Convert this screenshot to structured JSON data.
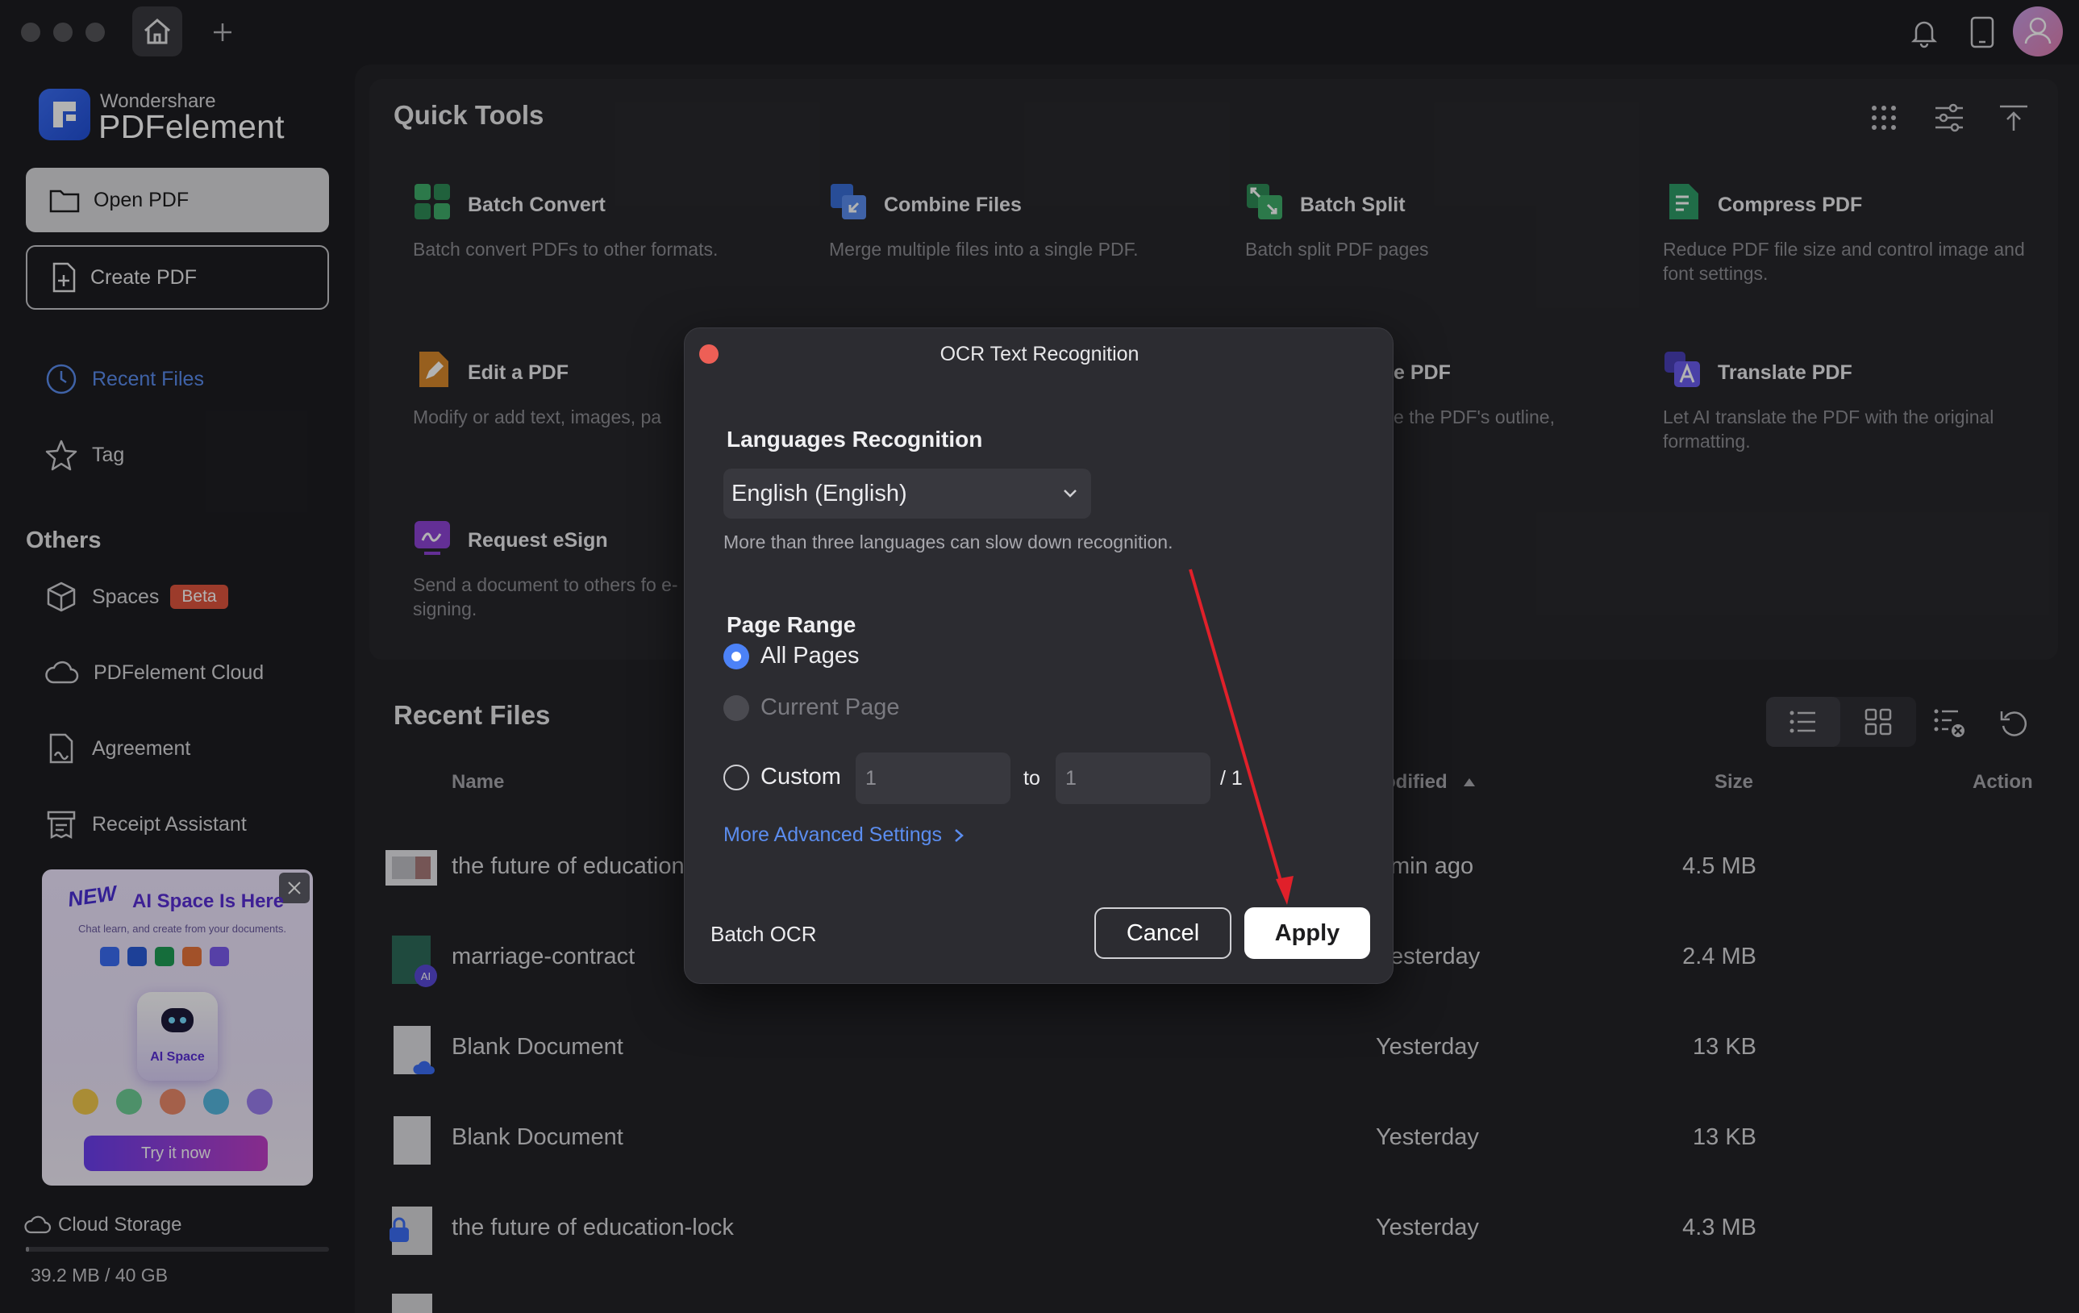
{
  "window": {
    "title_bar": {
      "home_tab_icon": "home-icon",
      "new_tab_icon": "plus-icon"
    }
  },
  "sidebar": {
    "brand_small": "Wondershare",
    "brand_big": "PDFelement",
    "open_pdf": "Open PDF",
    "create_pdf": "Create PDF",
    "nav": [
      {
        "label": "Recent Files",
        "icon": "clock-icon",
        "active": true
      },
      {
        "label": "Tag",
        "icon": "star-icon"
      }
    ],
    "others_title": "Others",
    "others": [
      {
        "label": "Spaces",
        "icon": "cube-icon",
        "badge": "Beta"
      },
      {
        "label": "PDFelement Cloud",
        "icon": "cloud-icon"
      },
      {
        "label": "Agreement",
        "icon": "agreement-icon"
      },
      {
        "label": "Receipt Assistant",
        "icon": "receipt-icon"
      }
    ],
    "promo": {
      "new_tag": "NEW",
      "title": "AI Space Is Here",
      "subtitle": "Chat learn, and create from your documents.",
      "core_label": "AI Space",
      "button": "Try it now"
    },
    "storage": {
      "label": "Cloud Storage",
      "value": "39.2 MB / 40 GB",
      "used_fraction": 0.001
    }
  },
  "quick_tools": {
    "title": "Quick Tools",
    "tools": [
      {
        "name": "Batch Convert",
        "desc": "Batch convert PDFs to other formats.",
        "icon": "batch-convert-icon"
      },
      {
        "name": "Combine Files",
        "desc": "Merge multiple files into a single PDF.",
        "icon": "combine-files-icon"
      },
      {
        "name": "Batch Split",
        "desc": "Batch split PDF pages",
        "icon": "batch-split-icon"
      },
      {
        "name": "Compress PDF",
        "desc": "Reduce PDF file size and control image and font settings.",
        "icon": "compress-pdf-icon"
      },
      {
        "name": "Edit a PDF",
        "desc": "Modify or add text, images, pa",
        "icon": "edit-pdf-icon"
      },
      {
        "name": "e PDF",
        "desc": "e the PDF's outline,",
        "icon": ""
      },
      {
        "name": "Translate PDF",
        "desc": "Let AI translate the PDF with the original formatting.",
        "icon": "translate-pdf-icon"
      },
      {
        "name": "Request eSign",
        "desc": "Send a document to others fo e-signing.",
        "icon": "esign-icon"
      }
    ]
  },
  "recent_files": {
    "title": "Recent Files",
    "columns": {
      "name": "Name",
      "modified": "odified",
      "size": "Size",
      "action": "Action"
    },
    "rows": [
      {
        "name": "the future of education",
        "modified": "min ago",
        "size": "4.5 MB"
      },
      {
        "name": "marriage-contract",
        "modified": "esterday",
        "size": "2.4 MB"
      },
      {
        "name": "Blank Document",
        "modified": "Yesterday",
        "size": "13 KB"
      },
      {
        "name": "Blank Document",
        "modified": "Yesterday",
        "size": "13 KB"
      },
      {
        "name": "the future of education-lock",
        "modified": "Yesterday",
        "size": "4.3 MB"
      }
    ]
  },
  "dialog": {
    "title": "OCR Text Recognition",
    "languages_heading": "Languages Recognition",
    "language_selected": "English (English)",
    "language_hint": "More than three languages can slow down recognition.",
    "page_range_heading": "Page Range",
    "options": {
      "all": "All Pages",
      "current": "Current Page",
      "custom": "Custom"
    },
    "custom_from": "1",
    "custom_to": "1",
    "to_label": "to",
    "of_label": "/ 1",
    "advanced": "More Advanced Settings",
    "batch_ocr": "Batch OCR",
    "cancel": "Cancel",
    "apply": "Apply"
  },
  "colors": {
    "accent": "#4c82f7",
    "link": "#5b8def",
    "arrow": "#e0202a",
    "badge": "#e0553e"
  }
}
